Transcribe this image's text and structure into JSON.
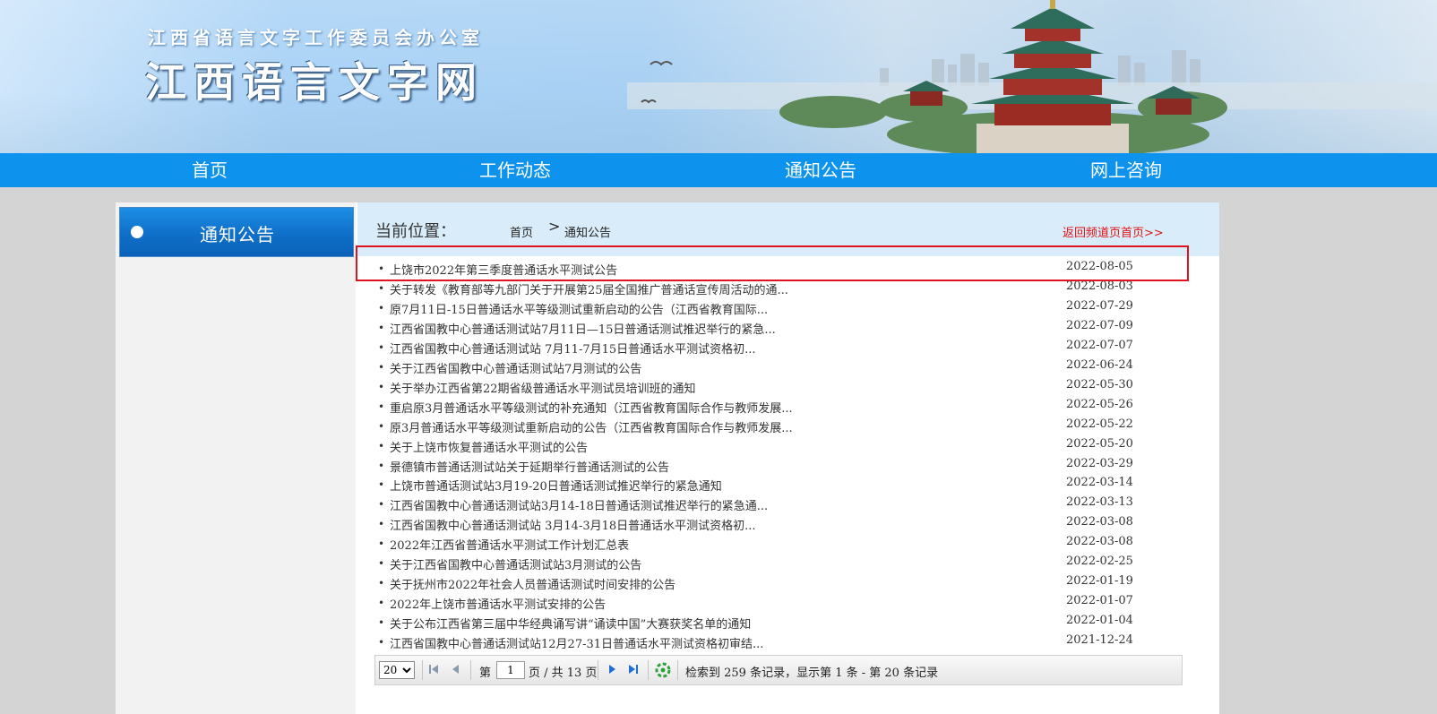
{
  "banner": {
    "subtitle": "江西省语言文字工作委员会办公室",
    "title": "江西语言文字网"
  },
  "nav": [
    {
      "label": "首页"
    },
    {
      "label": "工作动态"
    },
    {
      "label": "通知公告"
    },
    {
      "label": "网上咨询"
    }
  ],
  "sidebar": {
    "title": "通知公告"
  },
  "breadcrumb": {
    "label": "当前位置：",
    "home": "首页",
    "separator": ">",
    "current": "通知公告",
    "back_link": "返回频道页首页>>"
  },
  "notices": [
    {
      "title": "上饶市2022年第三季度普通话水平测试公告",
      "date": "2022-08-05"
    },
    {
      "title": "关于转发《教育部等九部门关于开展第25届全国推广普通话宣传周活动的通...",
      "date": "2022-08-03"
    },
    {
      "title": "原7月11日-15日普通话水平等级测试重新启动的公告（江西省教育国际...",
      "date": "2022-07-29"
    },
    {
      "title": "江西省国教中心普通话测试站7月11日—15日普通话测试推迟举行的紧急...",
      "date": "2022-07-09"
    },
    {
      "title": "江西省国教中心普通话测试站 7月11-7月15日普通话水平测试资格初...",
      "date": "2022-07-07"
    },
    {
      "title": "关于江西省国教中心普通话测试站7月测试的公告",
      "date": "2022-06-24"
    },
    {
      "title": "关于举办江西省第22期省级普通话水平测试员培训班的通知",
      "date": "2022-05-30"
    },
    {
      "title": "重启原3月普通话水平等级测试的补充通知（江西省教育国际合作与教师发展...",
      "date": "2022-05-26"
    },
    {
      "title": "原3月普通话水平等级测试重新启动的公告（江西省教育国际合作与教师发展...",
      "date": "2022-05-22"
    },
    {
      "title": "关于上饶市恢复普通话水平测试的公告",
      "date": "2022-05-20"
    },
    {
      "title": "景德镇市普通话测试站关于延期举行普通话测试的公告",
      "date": "2022-03-29"
    },
    {
      "title": "上饶市普通话测试站3月19-20日普通话测试推迟举行的紧急通知",
      "date": "2022-03-14"
    },
    {
      "title": "江西省国教中心普通话测试站3月14-18日普通话测试推迟举行的紧急通...",
      "date": "2022-03-13"
    },
    {
      "title": "江西省国教中心普通话测试站 3月14-3月18日普通话水平测试资格初...",
      "date": "2022-03-08"
    },
    {
      "title": "2022年江西省普通话水平测试工作计划汇总表",
      "date": "2022-03-08"
    },
    {
      "title": "关于江西省国教中心普通话测试站3月测试的公告",
      "date": "2022-02-25"
    },
    {
      "title": "关于抚州市2022年社会人员普通话测试时间安排的公告",
      "date": "2022-01-19"
    },
    {
      "title": "2022年上饶市普通话水平测试安排的公告",
      "date": "2022-01-07"
    },
    {
      "title": "关于公布江西省第三届中华经典诵写讲“诵读中国”大赛获奖名单的通知",
      "date": "2022-01-04"
    },
    {
      "title": "江西省国教中心普通话测试站12月27-31日普通话水平测试资格初审结...",
      "date": "2021-12-24"
    }
  ],
  "pager": {
    "page_size": "20",
    "page_label_pre": "第",
    "current_page": "1",
    "page_label_post": "页 / 共 13 页",
    "summary": "检索到 259 条记录，显示第 1 条 - 第 20 条记录"
  },
  "colors": {
    "nav_bg": "#0d93ee",
    "highlight_border": "#e0141e",
    "back_link": "#e01010",
    "crumb_bg": "#d9ecf9"
  },
  "icons": [
    "first-page-icon",
    "prev-page-icon",
    "next-page-icon",
    "last-page-icon",
    "refresh-icon",
    "bullet-dot-icon"
  ]
}
